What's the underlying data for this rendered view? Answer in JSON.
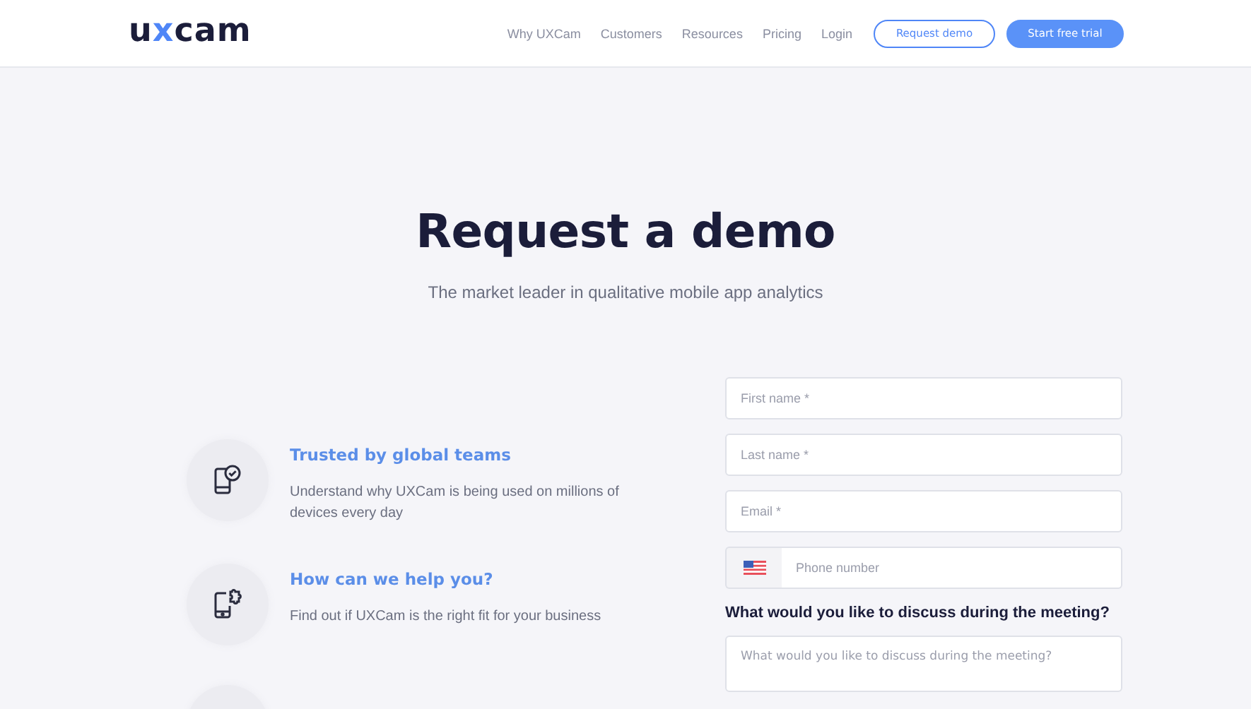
{
  "header": {
    "logo": [
      {
        "text": "u",
        "accent": false
      },
      {
        "text": "x",
        "accent": true
      },
      {
        "text": "cam",
        "accent": false
      }
    ],
    "nav": [
      "Why UXCam",
      "Customers",
      "Resources",
      "Pricing",
      "Login"
    ],
    "buttons": [
      {
        "label": "Request demo",
        "kind": "outline"
      },
      {
        "label": "Start free trial",
        "kind": "solid"
      }
    ]
  },
  "hero": {
    "title": "Request a demo",
    "subtitle": "The market leader in qualitative mobile app analytics"
  },
  "features": [
    {
      "kind": "phone-check",
      "title": "Trusted by global teams",
      "text": "Understand why UXCam is being used on millions of devices every day"
    },
    {
      "kind": "phone-puzzle",
      "title": "How can we help you?",
      "text": "Find out if UXCam is the right fit for your business"
    },
    {
      "kind": "blank"
    }
  ],
  "form": {
    "fields": [
      {
        "kind": "text",
        "placeholder": "First name *"
      },
      {
        "kind": "text",
        "placeholder": "Last name *"
      },
      {
        "kind": "text",
        "placeholder": "Email *"
      },
      {
        "kind": "phone",
        "placeholder": "Phone number"
      }
    ],
    "question": "What would you like to discuss during the meeting?",
    "textarea": {
      "placeholder": "What would you like to discuss during the meeting?"
    }
  }
}
